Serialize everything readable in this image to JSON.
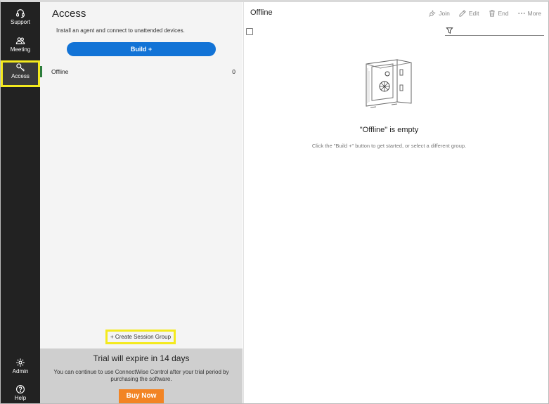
{
  "nav": {
    "items": [
      {
        "label": "Support",
        "icon": "headset-icon"
      },
      {
        "label": "Meeting",
        "icon": "people-icon"
      },
      {
        "label": "Access",
        "icon": "key-icon"
      }
    ],
    "bottom": [
      {
        "label": "Admin",
        "icon": "gear-icon"
      },
      {
        "label": "Help",
        "icon": "question-icon"
      }
    ]
  },
  "middle": {
    "title": "Access",
    "description": "Install an agent and connect to unattended devices.",
    "build_label": "Build +",
    "groups": [
      {
        "name": "Offline",
        "count": "0"
      }
    ],
    "create_group_label": "+ Create Session Group",
    "trial": {
      "title": "Trial will expire in 14 days",
      "text": "You can continue to use ConnectWise Control after your trial period by purchasing the software.",
      "buy_label": "Buy Now"
    }
  },
  "right": {
    "title": "Offline",
    "toolbar": {
      "join": "Join",
      "edit": "Edit",
      "end": "End",
      "more": "More"
    },
    "empty_title": "\"Offline\" is empty",
    "empty_subtitle": "Click the \"Build +\" button to get started, or select a different group."
  },
  "colors": {
    "nav_bg": "#222222",
    "accent_blue": "#1273d6",
    "buy_orange": "#f28424",
    "highlight_yellow": "#f4ea1e",
    "group_green": "#2c7d3c"
  }
}
